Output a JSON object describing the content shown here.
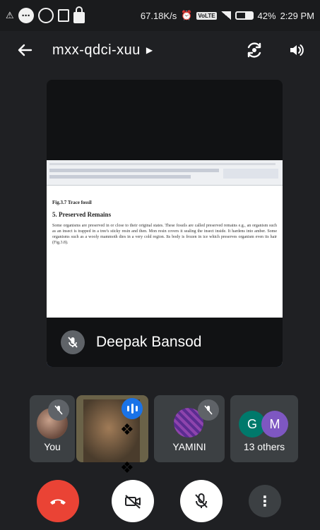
{
  "status_bar": {
    "net_speed": "67.18K/s",
    "volte": "VoLTE",
    "battery": "42%",
    "time": "2:29 PM"
  },
  "header": {
    "meeting_code": "mxx-qdci-xuu"
  },
  "presentation": {
    "presenter_name": "Deepak Bansod",
    "doc_figure": "Fig.3.7 Trace fossil",
    "doc_heading": "5. Preserved Remains",
    "doc_paragraph": "Some organisms are preserved in or close to their original states. These fossils are called preserved remains e.g., an organism such as an insect is trapped in a tree's sticky resin and then. Mon resin covers it sealing the insect inside. It hardens into amber. Some organisms such as a wooly mammoth dies in a very cold region. Its body is frozen in ice which preserves organism even its hair (Fig.3.8)."
  },
  "participants": {
    "you_label": "You",
    "yamini_label": "YAMINI",
    "others_label": "13 others",
    "initials": [
      "G",
      "M"
    ]
  },
  "colors": {
    "end_call": "#ea4335",
    "speaking": "#1a73e8",
    "initial_g": "#00796b",
    "initial_m": "#7e57c2"
  }
}
